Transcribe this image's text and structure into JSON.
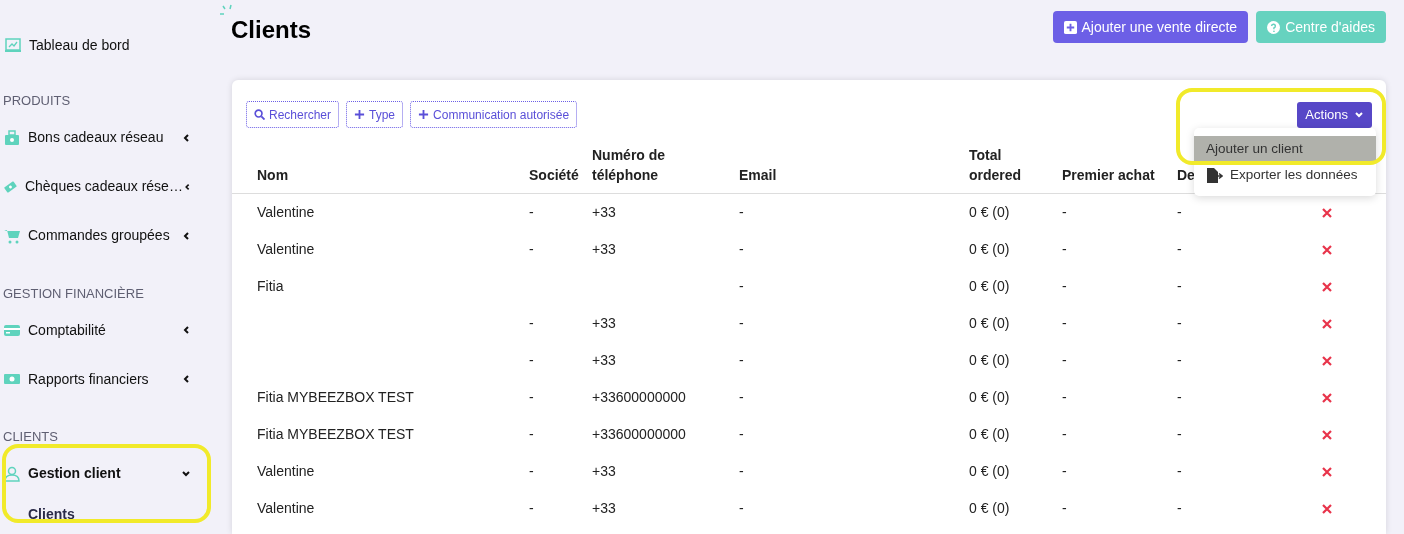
{
  "sidebar": {
    "top_item": {
      "label": "Tableau de bord"
    },
    "sections": [
      {
        "title": "PRODUITS",
        "items": [
          {
            "label": "Bons cadeaux réseau",
            "expanded": false
          },
          {
            "label": "Chèques cadeaux rése…",
            "expanded": false
          },
          {
            "label": "Commandes groupées",
            "expanded": false
          }
        ]
      },
      {
        "title": "GESTION FINANCIÈRE",
        "items": [
          {
            "label": "Comptabilité",
            "expanded": false
          },
          {
            "label": "Rapports financiers",
            "expanded": false
          }
        ]
      },
      {
        "title": "CLIENTS",
        "items": [
          {
            "label": "Gestion client",
            "expanded": true,
            "children": [
              {
                "label": "Clients",
                "selected": true
              }
            ]
          }
        ]
      }
    ]
  },
  "page_title": "Clients",
  "header_buttons": [
    {
      "label": "Ajouter une vente directe",
      "kind": "primary"
    },
    {
      "label": "Centre d'aides",
      "kind": "help"
    }
  ],
  "filters": [
    {
      "label": "Rechercher",
      "kind": "search"
    },
    {
      "label": "Type",
      "kind": "add"
    },
    {
      "label": "Communication autorisée",
      "kind": "add"
    }
  ],
  "actions_menu": {
    "label": "Actions",
    "expanded": true,
    "items": [
      {
        "label": "Ajouter un client",
        "selected": true,
        "kind": "plain"
      },
      {
        "label": "Exporter les données",
        "selected": false,
        "kind": "export"
      }
    ]
  },
  "table": {
    "columns": [
      "Nom",
      "Société",
      "Numéro de téléphone",
      "Email",
      "Total ordered",
      "Premier achat",
      "De"
    ],
    "rows": [
      [
        "Valentine",
        "-",
        "+33",
        "-",
        "0 € (0)",
        "-",
        "-"
      ],
      [
        "Valentine",
        "-",
        "+33",
        "-",
        "0 € (0)",
        "-",
        "-"
      ],
      [
        "Fitia",
        "",
        "",
        "-",
        "0 € (0)",
        "-",
        "-"
      ],
      [
        "",
        "-",
        "+33",
        "-",
        "0 € (0)",
        "-",
        "-"
      ],
      [
        "",
        "-",
        "+33",
        "-",
        "0 € (0)",
        "-",
        "-"
      ],
      [
        "Fitia MYBEEZBOX TEST",
        "-",
        "+33600000000",
        "-",
        "0 € (0)",
        "-",
        "-"
      ],
      [
        "Fitia MYBEEZBOX TEST",
        "-",
        "+33600000000",
        "-",
        "0 € (0)",
        "-",
        "-"
      ],
      [
        "Valentine",
        "-",
        "+33",
        "-",
        "0 € (0)",
        "-",
        "-"
      ],
      [
        "Valentine",
        "-",
        "+33",
        "-",
        "0 € (0)",
        "-",
        "-"
      ]
    ]
  }
}
